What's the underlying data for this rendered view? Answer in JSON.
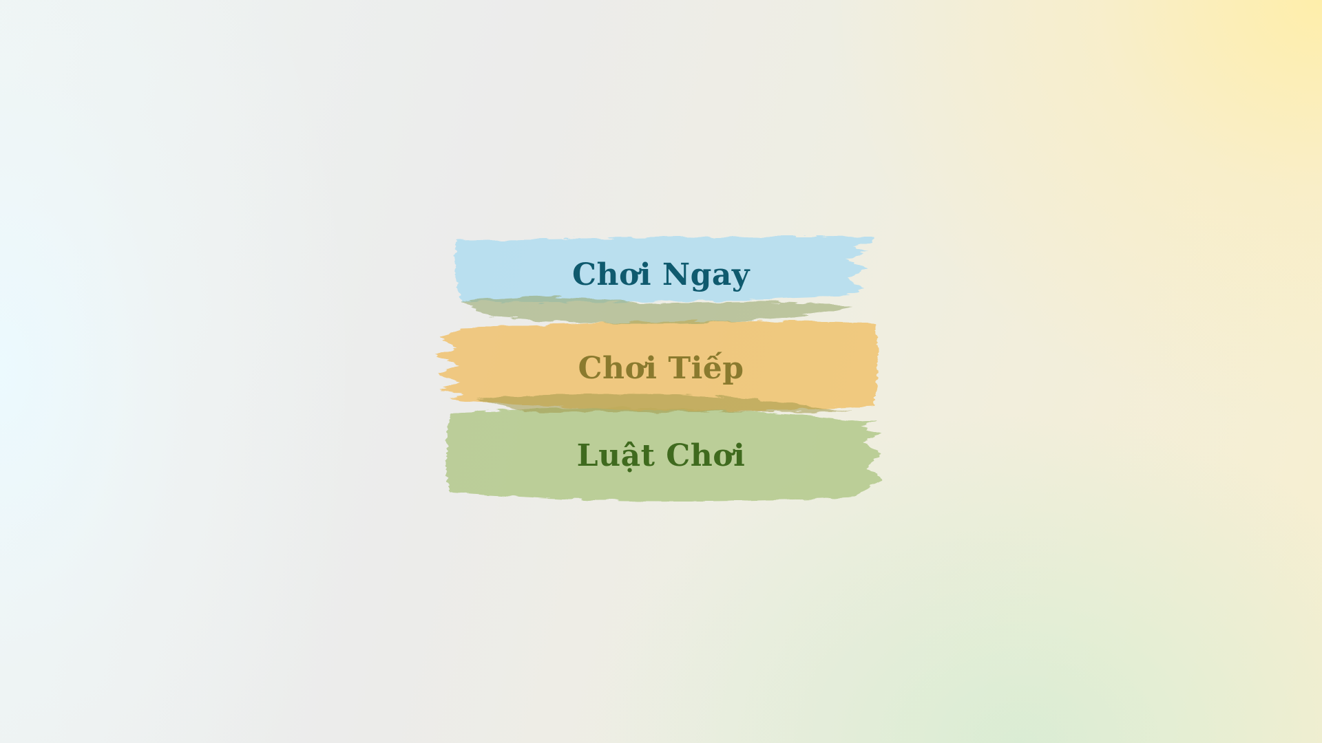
{
  "menu": {
    "items": [
      {
        "label": "Chơi Ngay",
        "text_color": "#0f5a6e",
        "brush_color": "#b6e0ec"
      },
      {
        "label": "Chơi Tiếp",
        "text_color": "#8a7a2e",
        "brush_color": "#f2c673"
      },
      {
        "label": "Luật Chơi",
        "text_color": "#3f6a1e",
        "brush_color": "#b9cc8f"
      }
    ]
  }
}
